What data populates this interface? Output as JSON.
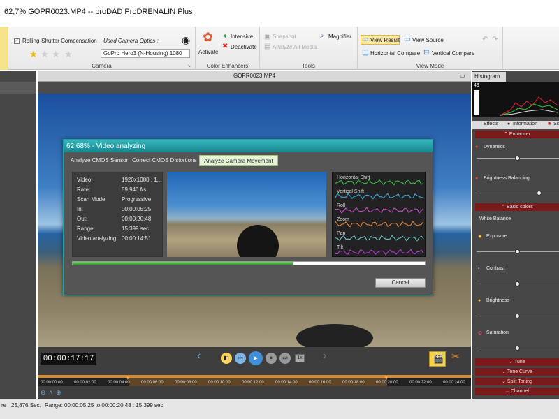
{
  "window": {
    "title": "62,7%  GOPR0023.MP4 -- proDAD ProDRENALIN Plus"
  },
  "ribbon": {
    "camera": {
      "rolling_shutter_label": "Rolling-Shutter Compensation",
      "used_optics_label": "Used Camera Optics :",
      "optics_value": "GoPro Hero3 (N-Housing) 1080",
      "group_label": "Camera"
    },
    "color": {
      "activate": "Activate",
      "intensive": "Intensive",
      "deactivate": "Deactivate",
      "group_label": "Color Enhancers"
    },
    "tools": {
      "snapshot": "Snapshot",
      "analyze_all": "Analyze All Media",
      "magnifier": "Magnifier",
      "group_label": "Tools"
    },
    "view": {
      "view_result": "View Result",
      "view_source": "View Source",
      "horizontal_compare": "Horizontal Compare",
      "vertical_compare": "Vertical Compare",
      "group_label": "View Mode"
    }
  },
  "viewer": {
    "filename": "GOPR0023.MP4"
  },
  "dialog": {
    "title": "62,68% - Video analyzing",
    "tabs": [
      "Analyze CMOS Sensor",
      "Correct CMOS Distortions",
      "Analyze Camera Movement"
    ],
    "active_tab": 2,
    "info": [
      {
        "k": "Video:",
        "v": "1920x1080  : 1..."
      },
      {
        "k": "Rate:",
        "v": "59,940 f/s"
      },
      {
        "k": "Scan Mode:",
        "v": "Progressive"
      },
      {
        "k": "In:",
        "v": "00:00:05:25"
      },
      {
        "k": "Out:",
        "v": "00:00:20:48"
      },
      {
        "k": "Range:",
        "v": "15,399 sec."
      },
      {
        "k": "Video analyzing:",
        "v": "00:00:14:51"
      }
    ],
    "graphs": [
      "Horizontal Shift",
      "Vertical Shift",
      "Roll",
      "Zoom",
      "Pan",
      "Tilt"
    ],
    "graph_colors": [
      "#3bd04a",
      "#35b8f0",
      "#d24fd8",
      "#f08a3c",
      "#6fd0d8",
      "#c040e0"
    ],
    "progress": 0.6268,
    "cancel": "Cancel"
  },
  "transport": {
    "timecode": "00:00:17:17",
    "rate_label": "1x",
    "ticks": [
      "00:00:00:00",
      "00:00:02:00",
      "00:00:04:00",
      "00:00:06:00",
      "00:00:08:00",
      "00:00:10:00",
      "00:00:12:00",
      "00:00:14:00",
      "00:00:16:00",
      "00:00:18:00",
      "00:00:20:00",
      "00:00:22:00",
      "00:00:24:00"
    ]
  },
  "status": {
    "left": "re",
    "duration": "25,876 Sec.",
    "range": "Range: 00:00:05:25 to 00:00:20:48 : 15,399 sec."
  },
  "right": {
    "histogram_label": "Histogram",
    "histogram_value": "49",
    "tabs": [
      "Effects",
      "Information",
      "Sc"
    ],
    "enhancer": "Enhancer",
    "dynamics": "Dynamics",
    "brightness_balancing": "Brightness Balancing",
    "basic_colors": "Basic colors",
    "white_balance": "White Balance",
    "exposure": "Exposure",
    "contrast": "Contrast",
    "brightness": "Brightness",
    "saturation": "Saturation",
    "sections_bottom": [
      "Tune",
      "Tone Curve",
      "Split Toning",
      "Channel"
    ],
    "slider_levels": {
      "dynamics": 0.5,
      "brightness_balancing": 0.78,
      "exposure": 0.5,
      "contrast": 0.5,
      "brightness": 0.5,
      "saturation": 0.5
    }
  }
}
